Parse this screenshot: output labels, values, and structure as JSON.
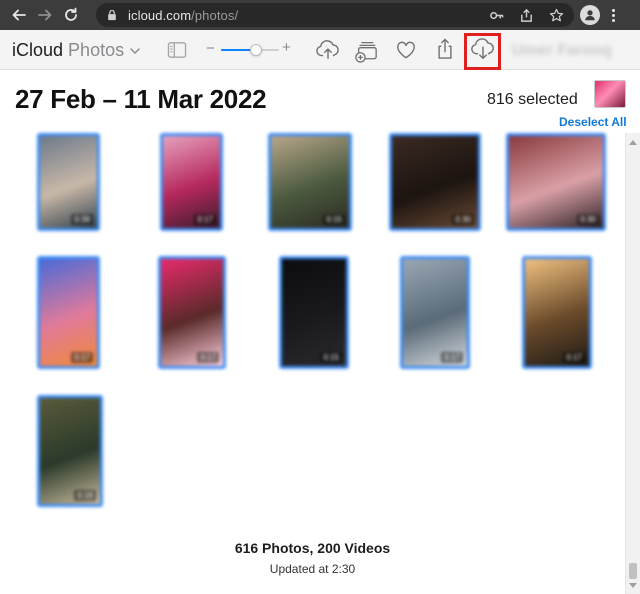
{
  "browser": {
    "url_host": "icloud.com",
    "url_path": "/photos/",
    "icons": [
      "back-arrow-icon",
      "forward-arrow-icon",
      "reload-icon",
      "lock-icon",
      "key-icon",
      "share-icon",
      "star-icon",
      "profile-icon",
      "kebab-menu-icon"
    ]
  },
  "toolbar": {
    "brand_icloud": "iCloud",
    "brand_app": "Photos",
    "zoom_minus": "−",
    "zoom_plus": "+",
    "zoom_level_fraction": 0.6,
    "user_name": "Umer Farooq",
    "icons": [
      "sidebar-toggle-icon",
      "upload-icon",
      "add-to-album-icon",
      "heart-icon",
      "share-icon",
      "download-icon"
    ]
  },
  "header": {
    "date_range": "27 Feb – 11 Mar 2022",
    "selected": "816 selected",
    "deselect_all": "Deselect All"
  },
  "grid": {
    "items": [
      {
        "duration": "0:39",
        "colors": [
          "#6d7a8a",
          "#c9b8a8",
          "#33434d"
        ]
      },
      {
        "duration": "0:17",
        "colors": [
          "#e7a1bd",
          "#b5285d",
          "#3a1c2c"
        ]
      },
      {
        "duration": "0:15",
        "colors": [
          "#b8a68a",
          "#4b5a3f",
          "#2b2a22"
        ]
      },
      {
        "duration": "0:30",
        "colors": [
          "#3a2a22",
          "#1c1410",
          "#6a4a36"
        ]
      },
      {
        "duration": "0:30",
        "colors": [
          "#8a3a3e",
          "#d9a0a6",
          "#2e2226"
        ]
      },
      {
        "duration": "0:17",
        "colors": [
          "#4a6ad8",
          "#e07a9a",
          "#f08a3a"
        ]
      },
      {
        "duration": "0:17",
        "colors": [
          "#e82a6a",
          "#5a2a2a",
          "#ffd0dc"
        ]
      },
      {
        "duration": "0:15",
        "colors": [
          "#0c0c0e",
          "#1a1a1e",
          "#2a2a2e"
        ]
      },
      {
        "duration": "0:17",
        "colors": [
          "#9aa8b4",
          "#5a6a78",
          "#d4d8dc"
        ]
      },
      {
        "duration": "0:17",
        "colors": [
          "#f0c080",
          "#6a4a2a",
          "#1e1a16"
        ]
      },
      {
        "duration": "0:19",
        "colors": [
          "#5a5a3a",
          "#2a3a2a",
          "#c8b89a"
        ]
      }
    ]
  },
  "footer": {
    "count": "616 Photos, 200 Videos",
    "updated": "Updated at 2:30"
  },
  "colors": {
    "selection_border": "#3d8df5",
    "highlight": "#e0201f",
    "link": "#1478d6"
  }
}
